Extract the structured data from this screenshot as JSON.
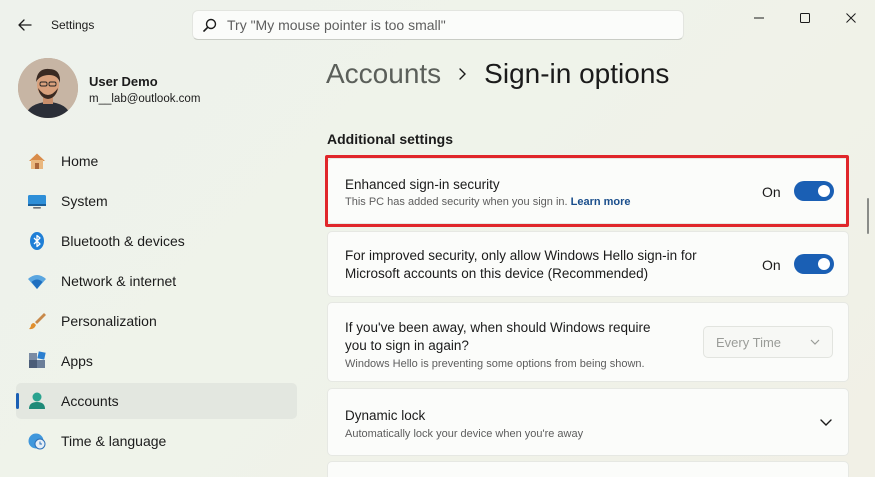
{
  "window": {
    "title": "Settings",
    "search_placeholder": "Try \"My mouse pointer is too small\""
  },
  "user": {
    "name": "User Demo",
    "email": "m__lab@outlook.com"
  },
  "sidebar": {
    "items": [
      {
        "label": "Home",
        "icon": "home-icon"
      },
      {
        "label": "System",
        "icon": "system-icon"
      },
      {
        "label": "Bluetooth & devices",
        "icon": "bluetooth-icon"
      },
      {
        "label": "Network & internet",
        "icon": "network-icon"
      },
      {
        "label": "Personalization",
        "icon": "brush-icon"
      },
      {
        "label": "Apps",
        "icon": "apps-icon"
      },
      {
        "label": "Accounts",
        "icon": "accounts-icon",
        "active": true
      },
      {
        "label": "Time & language",
        "icon": "globe-clock-icon"
      }
    ]
  },
  "breadcrumb": {
    "parent": "Accounts",
    "current": "Sign-in options"
  },
  "main": {
    "section_title": "Additional settings",
    "settings": [
      {
        "title": "Enhanced sign-in security",
        "description": "This PC has added security when you sign in.",
        "link": "Learn more",
        "state": "On"
      },
      {
        "title_line1": "For improved security, only allow Windows Hello sign-in for",
        "title_line2": "Microsoft accounts on this device (Recommended)",
        "state": "On"
      },
      {
        "title_line1": "If you've been away, when should Windows require",
        "title_line2": "you to sign in again?",
        "description": "Windows Hello is preventing some options from being shown.",
        "selected": "Every Time"
      },
      {
        "title": "Dynamic lock",
        "description": "Automatically lock your device when you're away"
      }
    ]
  },
  "colors": {
    "accent": "#1a5fb4",
    "highlight": "#e0262a"
  }
}
